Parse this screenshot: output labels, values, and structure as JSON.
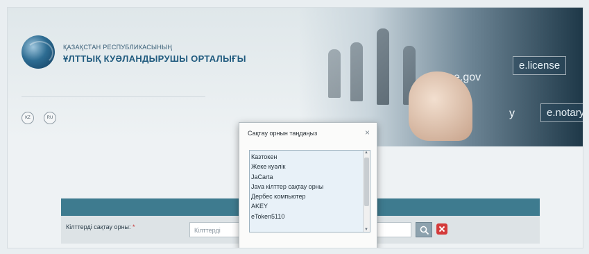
{
  "header": {
    "org_line1": "ҚАЗАҚСТАН РЕСПУБЛИКАСЫНЫҢ",
    "org_line2": "ҰЛТТЫҚ КУӘЛАНДЫРУШЫ ОРТАЛЫҒЫ",
    "languages": [
      "KZ",
      "RU"
    ]
  },
  "banner": {
    "tiles": [
      "e.gov",
      "e.license",
      "e.notary",
      "y"
    ]
  },
  "form": {
    "field_label": "Кілттерді сақтау орны:",
    "required_mark": "*",
    "input_placeholder": "Кілттерді"
  },
  "dialog": {
    "title": "Сақтау орнын таңдаңыз",
    "close": "×",
    "options": [
      "Казтокен",
      "Жеке куәлік",
      "JaCarta",
      "Java кілттер сақтау орны",
      "Дербес компьютер",
      "AKEY",
      "eToken5110"
    ]
  },
  "colors": {
    "accent_bar": "#3e7b8f",
    "clear_button": "#d43a3a",
    "brand_text": "#1f5a7e"
  }
}
